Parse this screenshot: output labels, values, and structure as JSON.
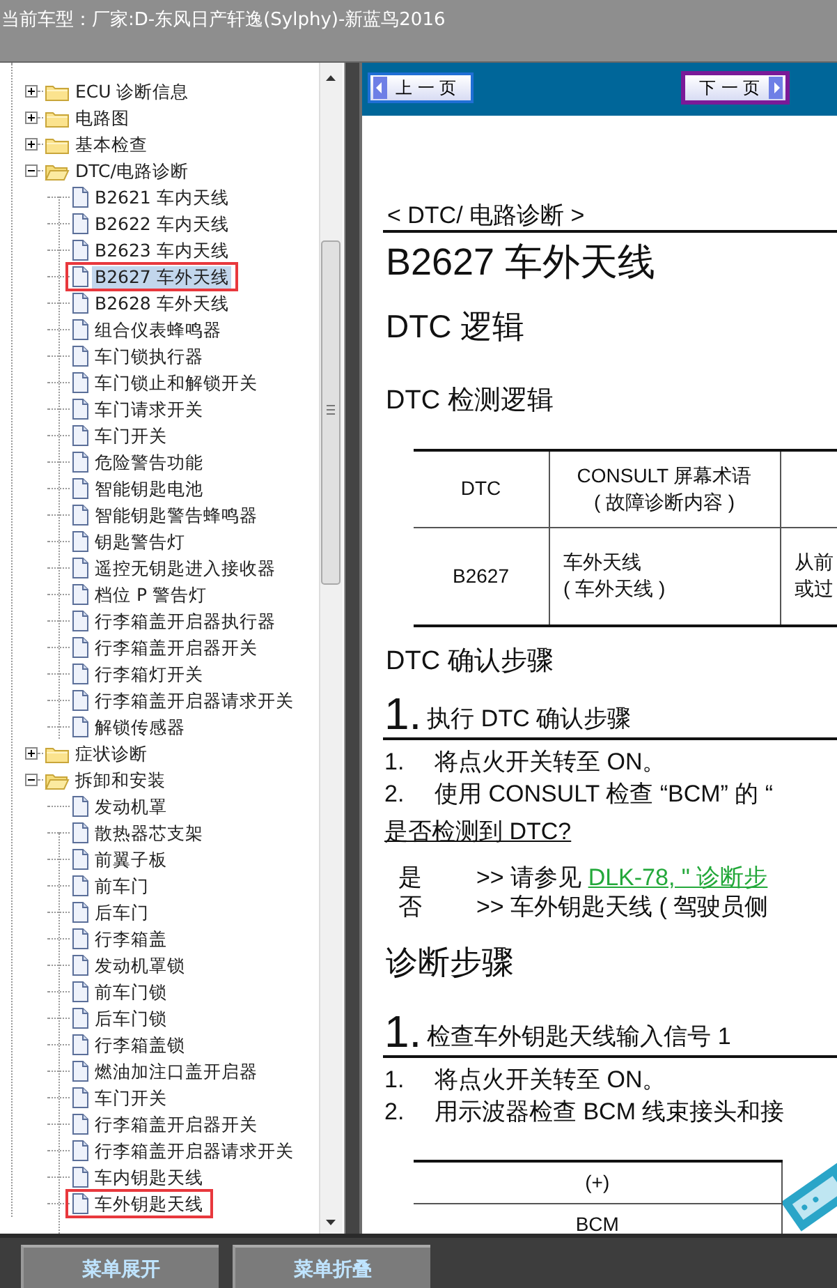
{
  "window": {
    "title": "当前车型：厂家:D-东风日产轩逸(Sylphy)-新蓝鸟2016"
  },
  "tree": {
    "items": [
      {
        "kind": "folder",
        "label": "ECU 诊断信息",
        "expanded": false,
        "selected": false,
        "marked": false
      },
      {
        "kind": "folder",
        "label": "电路图",
        "expanded": false,
        "selected": false,
        "marked": false
      },
      {
        "kind": "folder",
        "label": "基本检查",
        "expanded": false,
        "selected": false,
        "marked": false
      },
      {
        "kind": "folder",
        "label": "DTC/电路诊断",
        "expanded": true,
        "selected": false,
        "marked": false,
        "children": [
          {
            "kind": "page",
            "label": "B2621 车内天线",
            "selected": false,
            "marked": false
          },
          {
            "kind": "page",
            "label": "B2622 车内天线",
            "selected": false,
            "marked": false
          },
          {
            "kind": "page",
            "label": "B2623 车内天线",
            "selected": false,
            "marked": false
          },
          {
            "kind": "page",
            "label": "B2627 车外天线",
            "selected": true,
            "marked": true
          },
          {
            "kind": "page",
            "label": "B2628 车外天线",
            "selected": false,
            "marked": false
          },
          {
            "kind": "page",
            "label": "组合仪表蜂鸣器",
            "selected": false,
            "marked": false
          },
          {
            "kind": "page",
            "label": "车门锁执行器",
            "selected": false,
            "marked": false
          },
          {
            "kind": "page",
            "label": "车门锁止和解锁开关",
            "selected": false,
            "marked": false
          },
          {
            "kind": "page",
            "label": "车门请求开关",
            "selected": false,
            "marked": false
          },
          {
            "kind": "page",
            "label": "车门开关",
            "selected": false,
            "marked": false
          },
          {
            "kind": "page",
            "label": "危险警告功能",
            "selected": false,
            "marked": false
          },
          {
            "kind": "page",
            "label": "智能钥匙电池",
            "selected": false,
            "marked": false
          },
          {
            "kind": "page",
            "label": "智能钥匙警告蜂鸣器",
            "selected": false,
            "marked": false
          },
          {
            "kind": "page",
            "label": "钥匙警告灯",
            "selected": false,
            "marked": false
          },
          {
            "kind": "page",
            "label": "遥控无钥匙进入接收器",
            "selected": false,
            "marked": false
          },
          {
            "kind": "page",
            "label": "档位 P 警告灯",
            "selected": false,
            "marked": false
          },
          {
            "kind": "page",
            "label": "行李箱盖开启器执行器",
            "selected": false,
            "marked": false
          },
          {
            "kind": "page",
            "label": "行李箱盖开启器开关",
            "selected": false,
            "marked": false
          },
          {
            "kind": "page",
            "label": "行李箱灯开关",
            "selected": false,
            "marked": false
          },
          {
            "kind": "page",
            "label": "行李箱盖开启器请求开关",
            "selected": false,
            "marked": false
          },
          {
            "kind": "page",
            "label": "解锁传感器",
            "selected": false,
            "marked": false
          }
        ]
      },
      {
        "kind": "folder",
        "label": "症状诊断",
        "expanded": false,
        "selected": false,
        "marked": false
      },
      {
        "kind": "folder",
        "label": "拆卸和安装",
        "expanded": true,
        "selected": false,
        "marked": false,
        "children": [
          {
            "kind": "page",
            "label": "发动机罩",
            "selected": false,
            "marked": false
          },
          {
            "kind": "page",
            "label": "散热器芯支架",
            "selected": false,
            "marked": false
          },
          {
            "kind": "page",
            "label": "前翼子板",
            "selected": false,
            "marked": false
          },
          {
            "kind": "page",
            "label": "前车门",
            "selected": false,
            "marked": false
          },
          {
            "kind": "page",
            "label": "后车门",
            "selected": false,
            "marked": false
          },
          {
            "kind": "page",
            "label": "行李箱盖",
            "selected": false,
            "marked": false
          },
          {
            "kind": "page",
            "label": "发动机罩锁",
            "selected": false,
            "marked": false
          },
          {
            "kind": "page",
            "label": "前车门锁",
            "selected": false,
            "marked": false
          },
          {
            "kind": "page",
            "label": "后车门锁",
            "selected": false,
            "marked": false
          },
          {
            "kind": "page",
            "label": "行李箱盖锁",
            "selected": false,
            "marked": false
          },
          {
            "kind": "page",
            "label": "燃油加注口盖开启器",
            "selected": false,
            "marked": false
          },
          {
            "kind": "page",
            "label": "车门开关",
            "selected": false,
            "marked": false
          },
          {
            "kind": "page",
            "label": "行李箱盖开启器开关",
            "selected": false,
            "marked": false
          },
          {
            "kind": "page",
            "label": "行李箱盖开启器请求开关",
            "selected": false,
            "marked": false
          },
          {
            "kind": "page",
            "label": "车内钥匙天线",
            "selected": false,
            "marked": false
          },
          {
            "kind": "page",
            "label": "车外钥匙天线",
            "selected": false,
            "marked": true
          }
        ]
      }
    ]
  },
  "nav": [
    {
      "label": "上 一 页",
      "kind": "prev",
      "focused": false
    },
    {
      "label": "下 一 页",
      "kind": "next",
      "focused": true
    }
  ],
  "document": [
    {
      "kind": "breadcrumb",
      "text": "< DTC/ 电路诊断 >"
    },
    {
      "kind": "title",
      "text": "B2627 车外天线"
    },
    {
      "kind": "h2",
      "text": "DTC 逻辑"
    },
    {
      "kind": "h3",
      "text": "DTC 检测逻辑"
    },
    {
      "kind": "table",
      "header": [
        [
          "DTC"
        ],
        [
          "CONSULT 屏幕术语",
          "( 故障诊断内容 )"
        ]
      ],
      "rows": [
        [
          [
            "B2627"
          ],
          [
            "车外天线",
            "( 车外天线 )"
          ],
          [
            "从前",
            "或过"
          ]
        ]
      ]
    },
    {
      "kind": "h3",
      "text": "DTC 确认步骤"
    },
    {
      "kind": "step",
      "number": "1.",
      "text": "执行 DTC 确认步骤"
    },
    {
      "kind": "item",
      "number": "1.",
      "text": "将点火开关转至 ON。"
    },
    {
      "kind": "item",
      "number": "2.",
      "text": "使用 CONSULT 检查 “BCM” 的 “"
    },
    {
      "kind": "question",
      "text": "是否检测到 DTC?"
    },
    {
      "kind": "answer",
      "label": "是",
      "text": ">> 请参见 ",
      "link": "DLK-78, \" 诊断步"
    },
    {
      "kind": "answer",
      "label": "否",
      "text": ">> 车外钥匙天线 ( 驾驶员侧"
    },
    {
      "kind": "h2",
      "text": "诊断步骤"
    },
    {
      "kind": "step",
      "number": "1.",
      "text": "检查车外钥匙天线输入信号 1"
    },
    {
      "kind": "item",
      "number": "1.",
      "text": "将点火开关转至 ON。"
    },
    {
      "kind": "item",
      "number": "2.",
      "text": "用示波器检查 BCM 线束接头和接"
    },
    {
      "kind": "figure-table",
      "header": [
        "(+)"
      ],
      "rows": [
        [
          "BCM"
        ]
      ]
    }
  ],
  "footer": {
    "buttons": [
      "菜单展开",
      "菜单折叠"
    ]
  }
}
